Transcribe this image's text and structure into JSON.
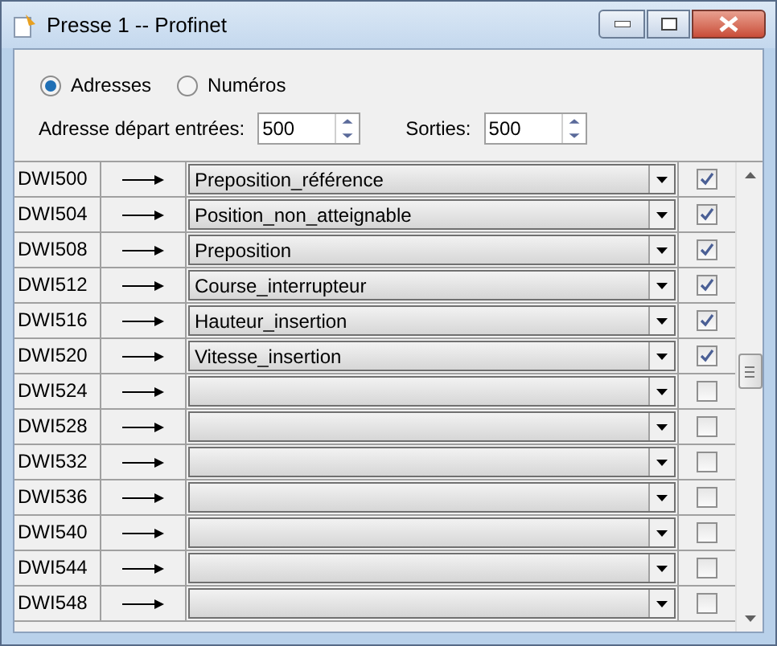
{
  "window": {
    "title": "Presse 1 -- Profinet"
  },
  "mode": [
    {
      "label": "Adresses",
      "selected": true
    },
    {
      "label": "Numéros",
      "selected": false
    }
  ],
  "start_inputs": {
    "label": "Adresse départ entrées:",
    "value": "500"
  },
  "outputs": {
    "label": "Sorties:",
    "value": "500"
  },
  "rows": [
    {
      "address": "DWI500",
      "value": "Preposition_référence",
      "checked": true
    },
    {
      "address": "DWI504",
      "value": "Position_non_atteignable",
      "checked": true
    },
    {
      "address": "DWI508",
      "value": "Preposition",
      "checked": true
    },
    {
      "address": "DWI512",
      "value": "Course_interrupteur",
      "checked": true
    },
    {
      "address": "DWI516",
      "value": "Hauteur_insertion",
      "checked": true
    },
    {
      "address": "DWI520",
      "value": "Vitesse_insertion",
      "checked": true
    },
    {
      "address": "DWI524",
      "checked": false
    },
    {
      "address": "DWI528",
      "checked": false
    },
    {
      "address": "DWI532",
      "checked": false
    },
    {
      "address": "DWI536",
      "checked": false
    },
    {
      "address": "DWI540",
      "checked": false
    },
    {
      "address": "DWI544",
      "checked": false
    },
    {
      "address": "DWI548",
      "checked": false
    }
  ]
}
